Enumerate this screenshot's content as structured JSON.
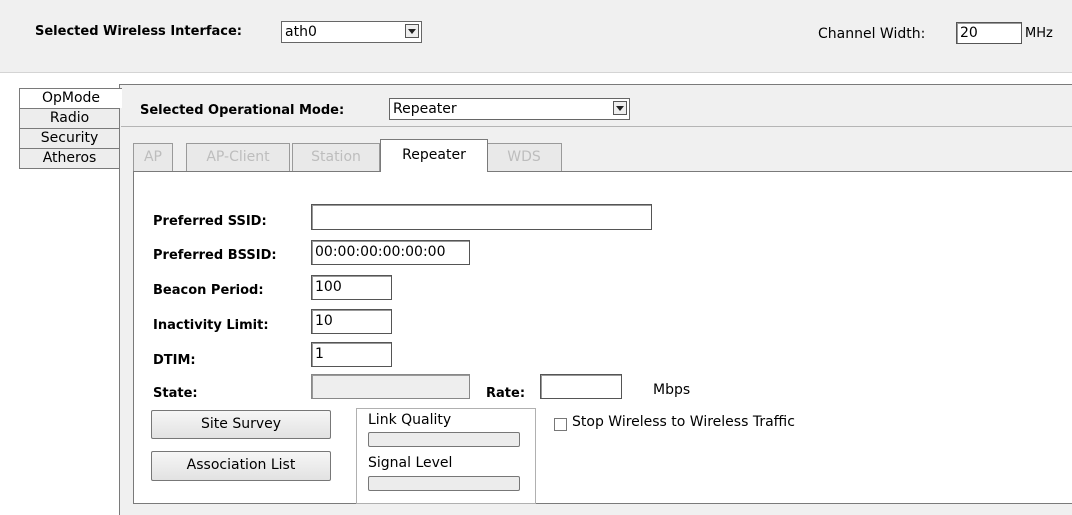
{
  "header": {
    "interface_label": "Selected Wireless Interface:",
    "interface_value": "ath0",
    "channel_width_label": "Channel Width:",
    "channel_width_value": "20",
    "channel_width_unit": "MHz"
  },
  "side_tabs": [
    "OpMode",
    "Radio",
    "Security",
    "Atheros"
  ],
  "opmode": {
    "label": "Selected Operational Mode:",
    "value": "Repeater"
  },
  "mode_tabs": [
    "AP",
    "AP-Client",
    "Station",
    "Repeater",
    "WDS"
  ],
  "form": {
    "ssid_label": "Preferred SSID:",
    "ssid_value": "",
    "bssid_label": "Preferred BSSID:",
    "bssid_value": "00:00:00:00:00:00",
    "beacon_label": "Beacon Period:",
    "beacon_value": "100",
    "inactivity_label": "Inactivity Limit:",
    "inactivity_value": "10",
    "dtim_label": "DTIM:",
    "dtim_value": "1",
    "state_label": "State:",
    "state_value": "",
    "rate_label": "Rate:",
    "rate_value": "",
    "rate_unit": "Mbps"
  },
  "buttons": {
    "site_survey": "Site Survey",
    "association_list": "Association List"
  },
  "link_box": {
    "link_quality_label": "Link Quality",
    "signal_level_label": "Signal Level"
  },
  "options": {
    "stop_traffic_label": "Stop Wireless to Wireless Traffic",
    "stop_traffic_checked": false
  }
}
